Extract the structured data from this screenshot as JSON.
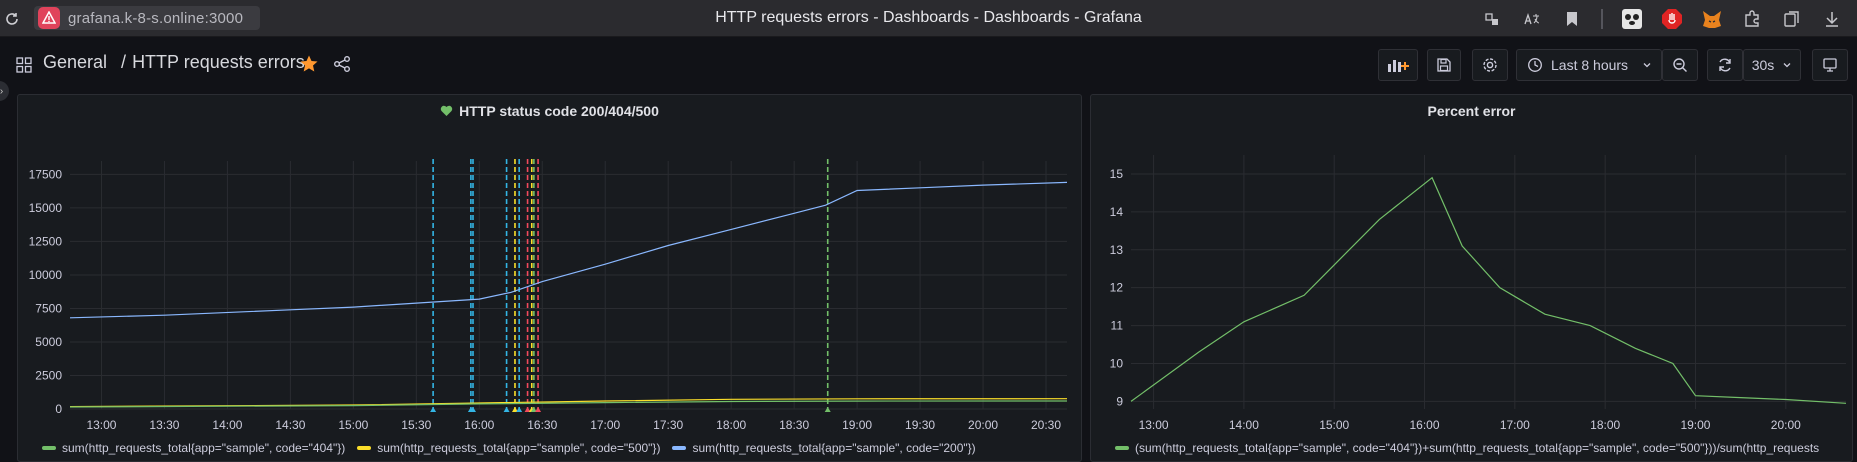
{
  "browser": {
    "url": "grafana.k-8-s.online:3000",
    "tab_title": "HTTP requests errors - Dashboards - Dashboards - Grafana",
    "extensions": [
      "tracking-protection-icon",
      "translate-icon",
      "bookmark-icon",
      "extension-panda-icon",
      "stop-hand-icon",
      "metamask-fox-icon",
      "puzzle-icon",
      "collections-icon",
      "download-icon"
    ]
  },
  "nav": {
    "folder": "General",
    "separator": "/",
    "dashboard": "HTTP requests errors",
    "time_range": "Last 8 hours",
    "refresh": "30s"
  },
  "colors": {
    "green": "#73bf69",
    "yellow": "#fade2a",
    "blue": "#8ab8ff",
    "bg": "#111217",
    "panel": "#181b1f"
  },
  "panels": [
    {
      "title": "HTTP status code 200/404/500",
      "legend": [
        {
          "label": "sum(http_requests_total{app=\"sample\", code=\"404\"})",
          "color": "#73bf69"
        },
        {
          "label": "sum(http_requests_total{app=\"sample\", code=\"500\"})",
          "color": "#fade2a"
        },
        {
          "label": "sum(http_requests_total{app=\"sample\", code=\"200\"})",
          "color": "#8ab8ff"
        }
      ]
    },
    {
      "title": "Percent error",
      "legend": [
        {
          "label": "(sum(http_requests_total{app=\"sample\", code=\"404\"})+sum(http_requests_total{app=\"sample\", code=\"500\"}))/sum(http_requests",
          "color": "#73bf69"
        }
      ]
    }
  ],
  "chart_data": [
    {
      "type": "line",
      "title": "HTTP status code 200/404/500",
      "x_ticks": [
        "13:00",
        "13:30",
        "14:00",
        "14:30",
        "15:00",
        "15:30",
        "16:00",
        "16:30",
        "17:00",
        "17:30",
        "18:00",
        "18:30",
        "19:00",
        "19:30",
        "20:00",
        "20:30"
      ],
      "xlim": [
        "12:45",
        "20:40"
      ],
      "ylim": [
        0,
        18500
      ],
      "y_ticks": [
        0,
        2500,
        5000,
        7500,
        10000,
        12500,
        15000,
        17500
      ],
      "grid": true,
      "legend_position": "bottom",
      "annotations_x": [
        "15:38",
        "15:56",
        "15:57",
        "16:13",
        "16:17",
        "16:19",
        "16:23",
        "16:25",
        "16:26",
        "16:28",
        "18:46"
      ],
      "series": [
        {
          "name": "sum(http_requests_total{app=\"sample\", code=\"200\"})",
          "color": "#8ab8ff",
          "x": [
            "12:45",
            "13:30",
            "14:30",
            "15:00",
            "15:30",
            "16:00",
            "16:15",
            "16:30",
            "17:00",
            "17:30",
            "18:00",
            "18:30",
            "18:45",
            "19:00",
            "19:30",
            "20:00",
            "20:40"
          ],
          "values": [
            6800,
            7000,
            7400,
            7600,
            7900,
            8200,
            8700,
            9500,
            10800,
            12200,
            13400,
            14600,
            15200,
            16300,
            16500,
            16700,
            16900
          ]
        },
        {
          "name": "sum(http_requests_total{app=\"sample\", code=\"500\"})",
          "color": "#fade2a",
          "x": [
            "12:45",
            "15:00",
            "16:00",
            "17:00",
            "18:00",
            "19:00",
            "20:40"
          ],
          "values": [
            180,
            300,
            450,
            600,
            720,
            760,
            770
          ]
        },
        {
          "name": "sum(http_requests_total{app=\"sample\", code=\"404\"})",
          "color": "#73bf69",
          "x": [
            "12:45",
            "15:00",
            "16:00",
            "17:00",
            "18:00",
            "19:00",
            "20:40"
          ],
          "values": [
            150,
            250,
            380,
            480,
            560,
            590,
            600
          ]
        }
      ]
    },
    {
      "type": "line",
      "title": "Percent error",
      "x_ticks": [
        "13:00",
        "14:00",
        "15:00",
        "16:00",
        "17:00",
        "18:00",
        "19:00",
        "20:00"
      ],
      "xlim": [
        "12:45",
        "20:40"
      ],
      "ylim": [
        8.8,
        15.5
      ],
      "y_ticks": [
        9,
        10,
        11,
        12,
        13,
        14,
        15
      ],
      "grid": true,
      "legend_position": "bottom",
      "series": [
        {
          "name": "(sum(http_requests_total{app=\"sample\", code=\"404\"})+sum(http_requests_total{app=\"sample\", code=\"500\"}))/sum(http_requests",
          "color": "#73bf69",
          "x": [
            "12:45",
            "13:30",
            "14:00",
            "14:40",
            "15:00",
            "15:30",
            "16:05",
            "16:25",
            "16:50",
            "17:20",
            "17:50",
            "18:20",
            "18:45",
            "19:00",
            "19:30",
            "20:00",
            "20:40"
          ],
          "values": [
            9.0,
            10.3,
            11.1,
            11.8,
            12.6,
            13.8,
            14.9,
            13.1,
            12.0,
            11.3,
            11.0,
            10.4,
            10.0,
            9.15,
            9.1,
            9.05,
            8.95
          ]
        }
      ]
    }
  ]
}
